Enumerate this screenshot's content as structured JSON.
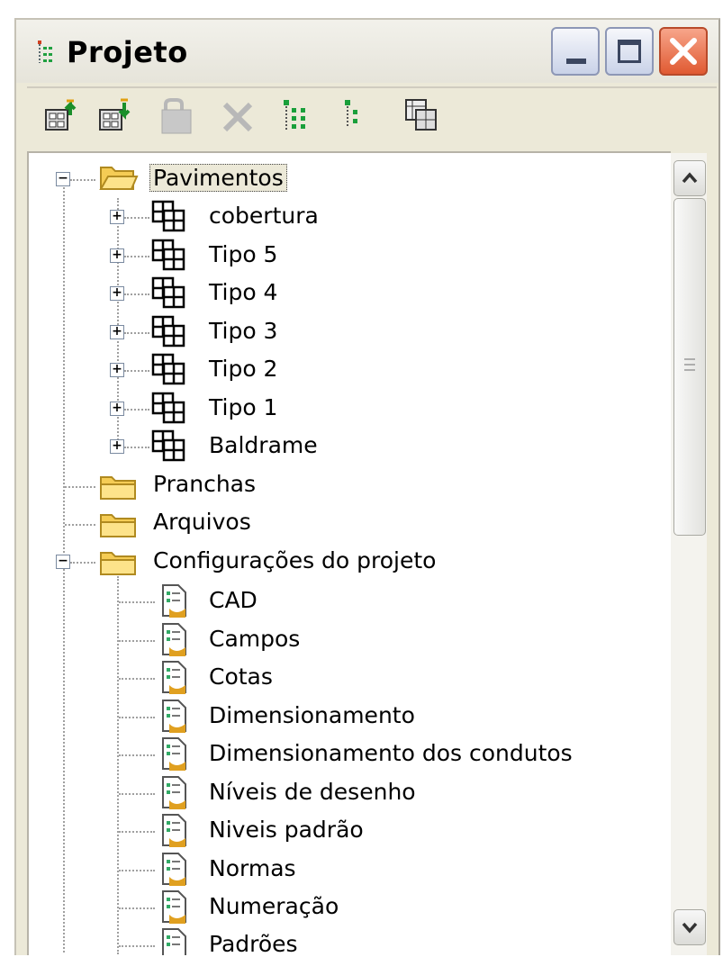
{
  "window": {
    "title": "Projeto"
  },
  "controls": {
    "minimize": "minimize-icon",
    "maximize": "maximize-icon",
    "close": "close-icon"
  },
  "toolbar": {
    "buttons": [
      {
        "icon": "add-floor-up-icon",
        "enabled": true
      },
      {
        "icon": "add-floor-down-icon",
        "enabled": true
      },
      {
        "icon": "folder-lock-icon",
        "enabled": false
      },
      {
        "icon": "delete-icon",
        "enabled": false
      },
      {
        "icon": "expand-tree-icon",
        "enabled": true
      },
      {
        "icon": "collapse-tree-icon",
        "enabled": true
      },
      {
        "icon": "floors-grid-icon",
        "enabled": true
      }
    ]
  },
  "tree": {
    "pavimentos": {
      "label": "Pavimentos",
      "children": [
        "cobertura",
        "Tipo 5",
        "Tipo 4",
        "Tipo 3",
        "Tipo 2",
        "Tipo 1",
        "Baldrame"
      ]
    },
    "pranchas": {
      "label": "Pranchas"
    },
    "arquivos": {
      "label": "Arquivos"
    },
    "configuracoes": {
      "label": "Configurações do projeto",
      "children": [
        "CAD",
        "Campos",
        "Cotas",
        "Dimensionamento",
        "Dimensionamento dos condutos",
        "Níveis de desenho",
        "Niveis padrão",
        "Normas",
        "Numeração",
        "Padrões"
      ]
    }
  },
  "colors": {
    "folder": "#f5cc55",
    "window_bg": "#ece9d8",
    "close_red": "#e05a32"
  }
}
